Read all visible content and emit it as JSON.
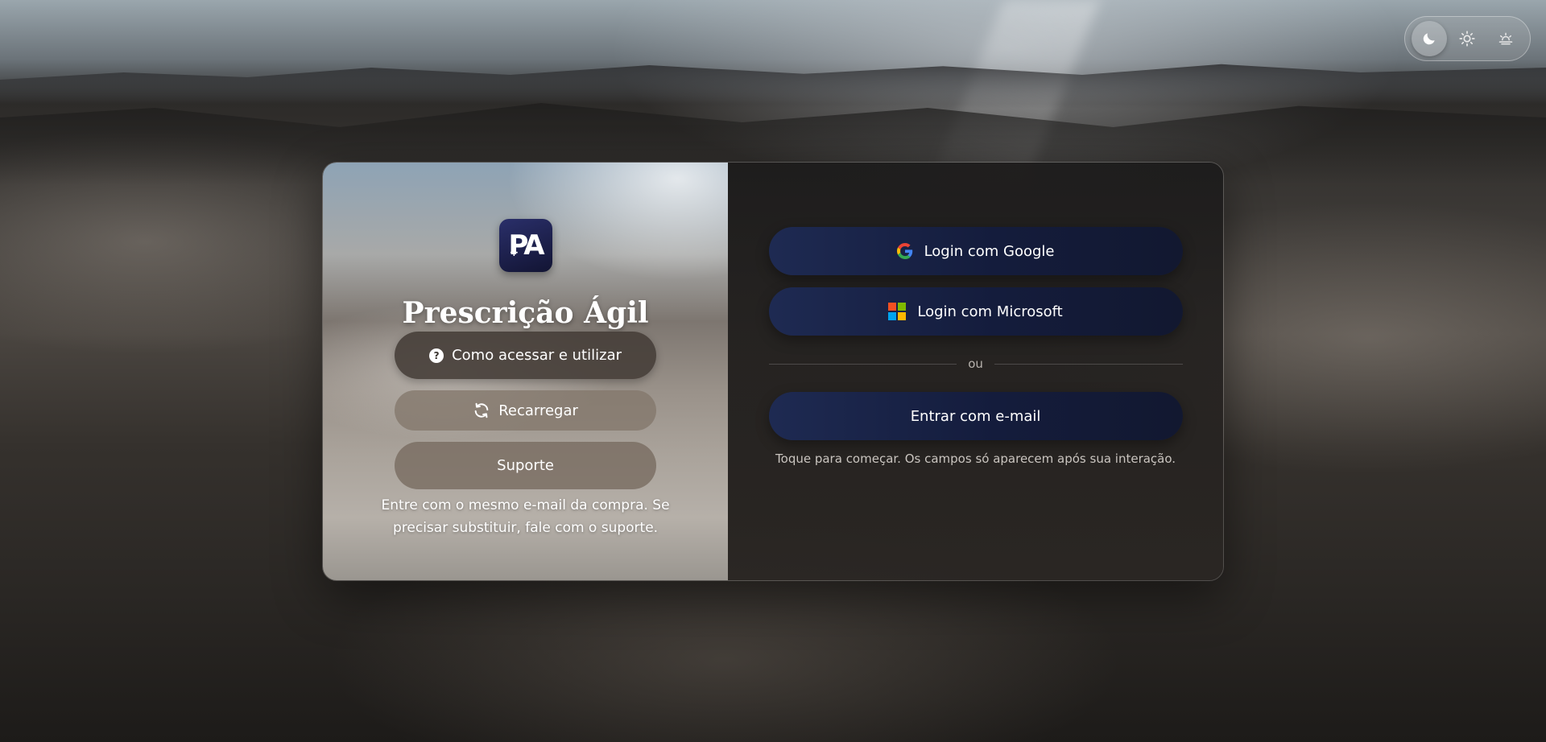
{
  "theme_switcher": {
    "options": [
      {
        "icon": "moon-icon",
        "active": true
      },
      {
        "icon": "sun-icon",
        "active": false
      },
      {
        "icon": "sunset-icon",
        "active": false
      }
    ]
  },
  "brand": {
    "logo_text": "PA",
    "title": "Prescrição Ágil"
  },
  "left": {
    "help_label": "Como acessar e utilizar",
    "help_icon": "question-circle-icon",
    "reload_label": "Recarregar",
    "reload_icon": "refresh-icon",
    "support_label": "Suporte",
    "note": "Entre com o mesmo e-mail da compra. Se precisar substituir, fale com o suporte."
  },
  "auth": {
    "google_label": "Login com Google",
    "microsoft_label": "Login com Microsoft",
    "divider_text": "ou",
    "email_label": "Entrar com e-mail",
    "hint": "Toque para começar. Os campos só aparecem após sua interação."
  },
  "colors": {
    "button_navy": "#141c3c",
    "google_blue": "#4285F4",
    "google_red": "#EA4335",
    "google_yellow": "#FBBC05",
    "google_green": "#34A853",
    "ms_red": "#F25022",
    "ms_green": "#7FBA00",
    "ms_blue": "#00A4EF",
    "ms_yellow": "#FFB900"
  }
}
